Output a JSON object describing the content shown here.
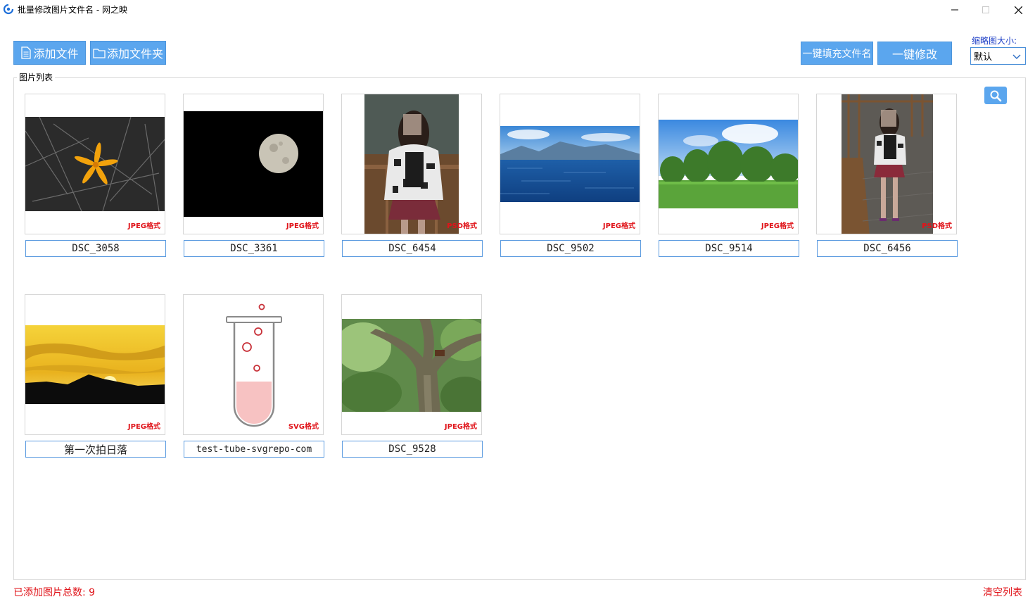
{
  "window": {
    "title": "批量修改图片文件名 - 网之映"
  },
  "toolbar": {
    "add_file_label": "添加文件",
    "add_folder_label": "添加文件夹",
    "fill_names_label": "一键填充文件名",
    "modify_label": "一键修改",
    "thumb_size_label": "缩略图大小:",
    "thumb_size_value": "默认"
  },
  "list": {
    "group_label": "图片列表",
    "images": [
      {
        "name": "DSC_3058",
        "format": "JPEG格式"
      },
      {
        "name": "DSC_3361",
        "format": "JPEG格式"
      },
      {
        "name": "DSC_6454",
        "format": "PSD格式"
      },
      {
        "name": "DSC_9502",
        "format": "JPEG格式"
      },
      {
        "name": "DSC_9514",
        "format": "JPEG格式"
      },
      {
        "name": "DSC_6456",
        "format": "PSD格式"
      },
      {
        "name": "第一次拍日落",
        "format": "JPEG格式"
      },
      {
        "name": "test-tube-svgrepo-com",
        "format": "SVG格式"
      },
      {
        "name": "DSC_9528",
        "format": "JPEG格式"
      }
    ]
  },
  "status": {
    "count_text": "已添加图片总数: 9",
    "clear_label": "清空列表"
  },
  "colors": {
    "accent": "#5ba6ee",
    "alert": "#e0141a",
    "label_blue": "#1a3cc6"
  }
}
